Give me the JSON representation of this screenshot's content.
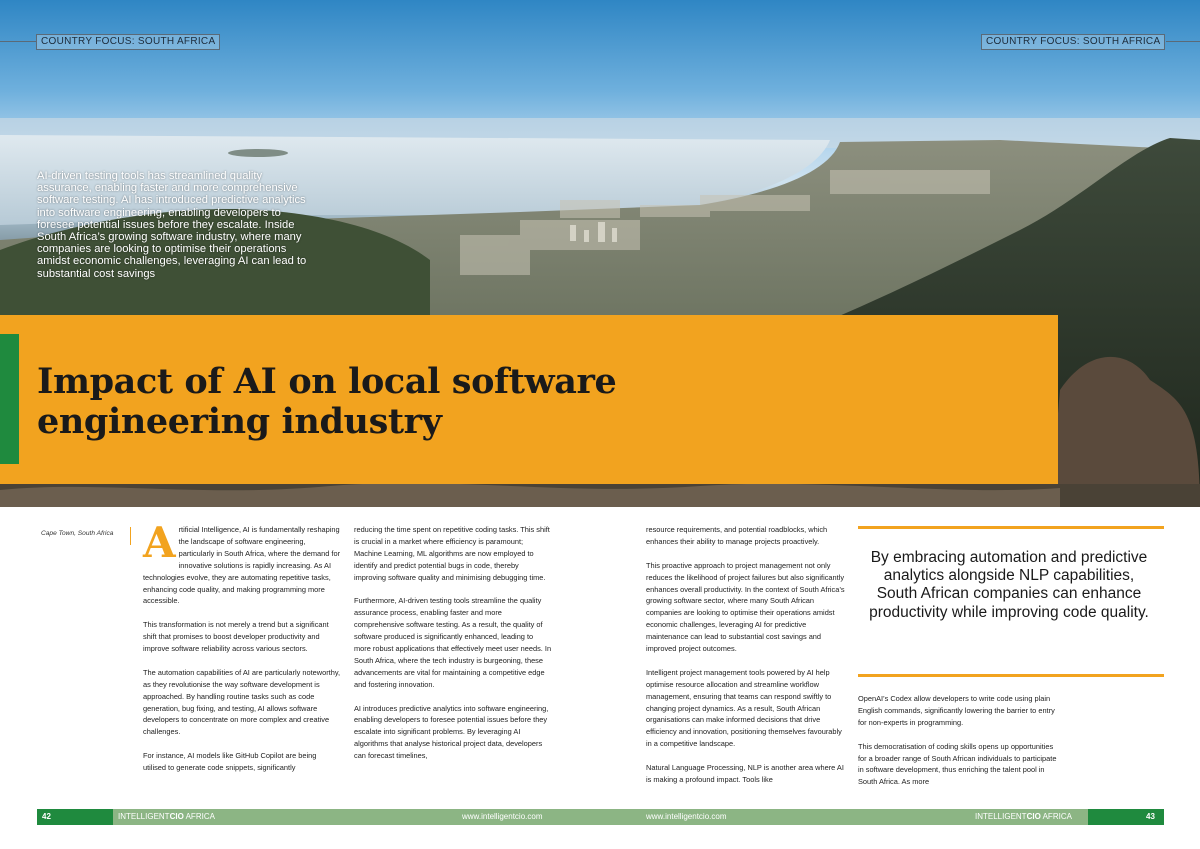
{
  "header": {
    "section_left": "COUNTRY FOCUS: SOUTH AFRICA",
    "section_right": "COUNTRY FOCUS: SOUTH AFRICA"
  },
  "hero": {
    "photo": "cape-town-aerial-photo",
    "intro": "AI-driven testing tools has streamlined quality assurance, enabling faster and more comprehensive software testing. AI has introduced predictive analytics into software engineering, enabling developers to foresee potential issues before they escalate. Inside South Africa’s growing software industry, where many companies are looking to optimise their operations amidst economic challenges, leveraging AI can lead to substantial cost savings"
  },
  "article": {
    "title_line1": "Impact of AI on local software",
    "title_line2": "engineering industry",
    "caption": "Cape Town, South Africa",
    "dropcap": "A",
    "col1": {
      "p1": "rtificial Intelligence, AI is fundamentally reshaping the landscape of software engineering, particularly in South Africa, where the demand for innovative solutions is rapidly increasing. As AI technologies evolve, they are automating repetitive tasks, enhancing code quality, and making programming more accessible.",
      "p2": "This transformation is not merely a trend but a significant shift that promises to boost developer productivity and improve software reliability across various sectors.",
      "p3": "The automation capabilities of AI are particularly noteworthy, as they revolutionise the way software development is approached. By handling routine tasks such as code generation, bug fixing, and testing, AI allows software developers to concentrate on more complex and creative challenges.",
      "p4": "For instance, AI models like GitHub Copilot are being utilised to generate code snippets, significantly"
    },
    "col2": {
      "p1": "reducing the time spent on repetitive coding tasks. This shift is crucial in a market where efficiency is paramount; Machine Learning, ML algorithms are now employed to identify and predict potential bugs in code, thereby improving software quality and minimising debugging time.",
      "p2": "Furthermore, AI-driven testing tools streamline the quality assurance process, enabling faster and more comprehensive software testing. As a result, the quality of software produced is significantly enhanced, leading to more robust applications that effectively meet user needs. In South Africa, where the tech industry is burgeoning, these advancements are vital for maintaining a competitive edge and fostering innovation.",
      "p3": "AI introduces predictive analytics into software engineering, enabling developers to foresee potential issues before they escalate into significant problems. By leveraging AI algorithms that analyse historical project data, developers can forecast timelines,"
    },
    "col3": {
      "p1": "resource requirements, and potential roadblocks, which enhances their ability to manage projects proactively.",
      "p2": "This proactive approach to project management not only reduces the likelihood of project failures but also significantly enhances overall productivity. In the context of South Africa’s growing software sector, where many South African companies are looking to optimise their operations amidst economic challenges, leveraging AI for predictive maintenance can lead to substantial cost savings and improved project outcomes.",
      "p3": "Intelligent project management tools powered by AI help optimise resource allocation and streamline workflow management, ensuring that teams can respond swiftly to changing project dynamics. As a result, South African organisations can make informed decisions that drive efficiency and innovation, positioning themselves favourably in a competitive landscape.",
      "p4": "Natural Language Processing, NLP is another area where AI is making a profound impact. Tools like"
    },
    "pullquote": "By embracing automation and predictive analytics alongside NLP capabilities, South African companies can enhance productivity while improving code quality.",
    "col4": {
      "p1": "OpenAI’s Codex allow developers to write code using plain English commands, significantly lowering the barrier to entry for non-experts in programming.",
      "p2": "This democratisation of coding skills opens up opportunities for a broader range of South African individuals to participate in software development, thus enriching the talent pool in South Africa. As more"
    }
  },
  "footer": {
    "page_left": "42",
    "page_right": "43",
    "brand_prefix": "INTELLIGENT",
    "brand_bold": "CIO",
    "brand_suffix": " AFRICA",
    "url_left": "www.intelligentcio.com",
    "url_right": "www.intelligentcio.com"
  },
  "colors": {
    "accent_orange": "#f2a31f",
    "accent_green": "#1f8a3e",
    "footer_green": "#8cb584"
  }
}
